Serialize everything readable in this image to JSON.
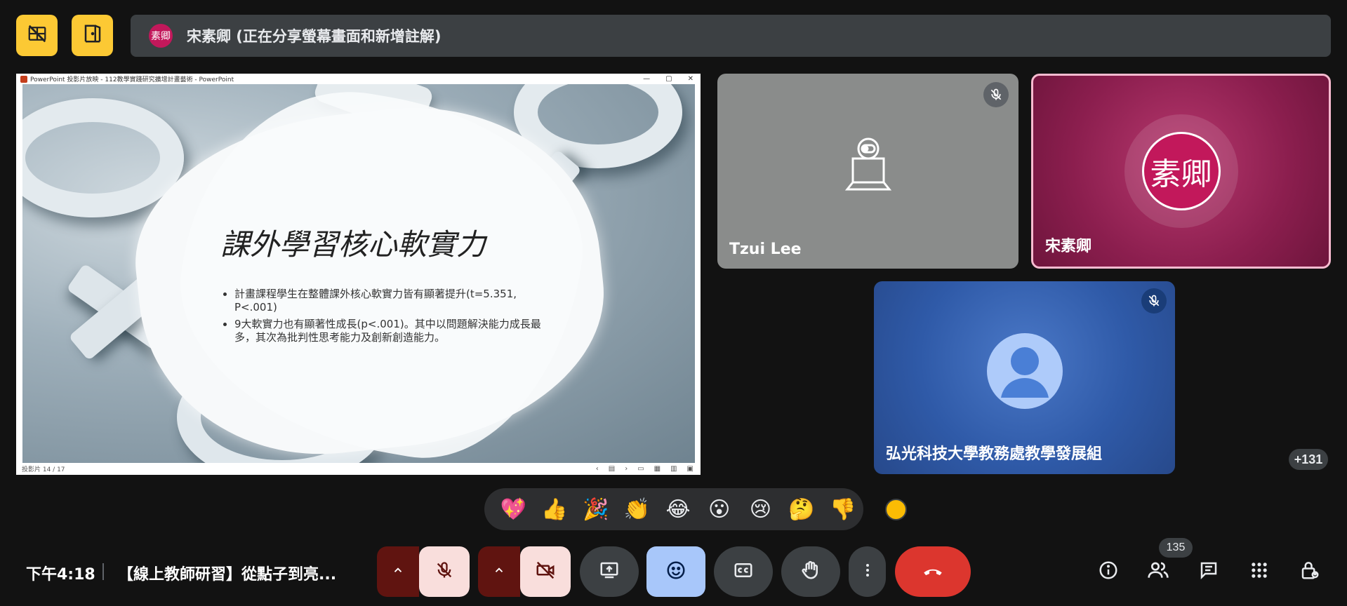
{
  "top_bar": {
    "presenter_initials": "素卿",
    "presenter_text": "宋素卿 (正在分享螢幕畫面和新增註解)",
    "left_buttons": [
      "hide-tiles-icon",
      "exit-door-icon"
    ]
  },
  "shared_window": {
    "titlebar": "PowerPoint 投影片放映 - 112教學實踐研究擴增計畫藝術 - PowerPoint",
    "controls": [
      "—",
      "▢",
      "✕"
    ],
    "slide_title": "課外學習核心軟實力",
    "bullets": [
      "計畫課程學生在整體課外核心軟實力皆有顯著提升(t=5.351, P<.001)",
      "9大軟實力也有顯著性成長(p<.001)。其中以問題解決能力成長最多，其次為批判性思考能力及創新創造能力。"
    ],
    "statusbar_left": "投影片 14 / 17",
    "statusbar_right": [
      "‹",
      "▤",
      "›",
      "▭",
      "▦",
      "▥",
      "▣"
    ]
  },
  "tiles": [
    {
      "name": "Tzui Lee",
      "muted": true,
      "video": "camera-off-placeholder"
    },
    {
      "name": "宋素卿",
      "initials": "素卿",
      "active_speaker": true,
      "avatar_color": "#c2185b"
    },
    {
      "name": "弘光科技大學教務處教學發展組",
      "muted": true,
      "avatar": "default-person"
    }
  ],
  "more_participants": "+131",
  "reactions": [
    "💖",
    "👍",
    "🎉",
    "👏",
    "😂",
    "😮",
    "😢",
    "🤔",
    "👎"
  ],
  "skin_tone_color": "#fbbc04",
  "bottom_bar": {
    "time": "下午4:18",
    "meeting_title": "【線上教師研習】從點子到亮...",
    "participant_count": "135"
  },
  "colors": {
    "accent_yellow": "#fcc934",
    "end_call_red": "#dc362e",
    "active_reactions_blue": "#a8c7fa",
    "muted_pink": "#f9dedc"
  }
}
